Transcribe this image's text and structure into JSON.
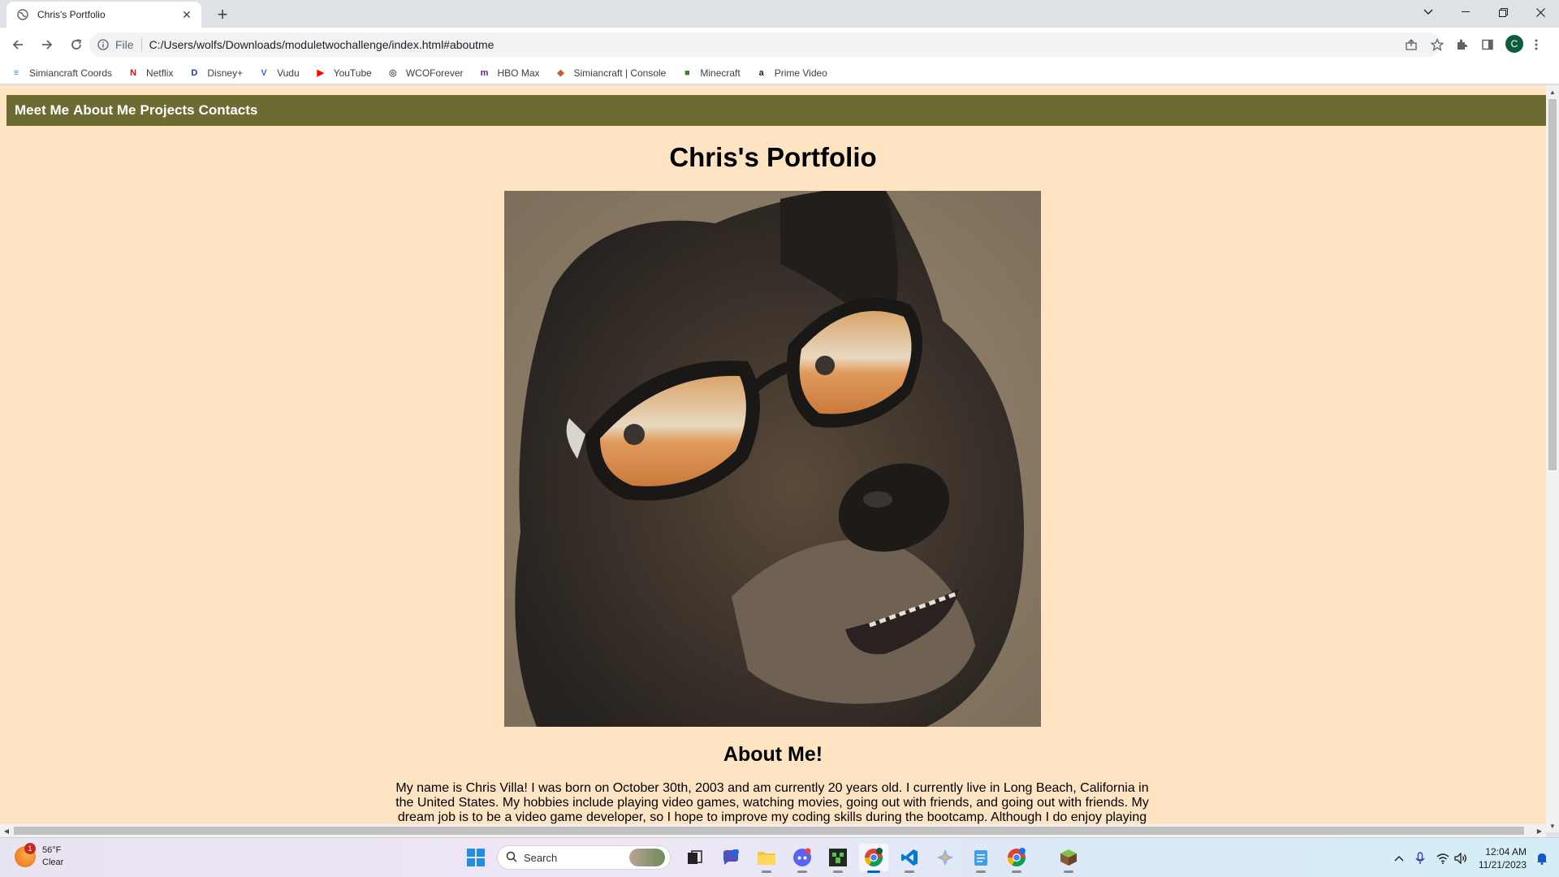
{
  "browser": {
    "tab_title": "Chris's Portfolio",
    "file_label": "File",
    "url": "C:/Users/wolfs/Downloads/moduletwochallenge/index.html#aboutme",
    "profile_initial": "C"
  },
  "bookmarks": [
    {
      "label": "Simiancraft Coords",
      "icon": "docs-icon",
      "color": "#4285f4"
    },
    {
      "label": "Netflix",
      "icon": "netflix-icon",
      "color": "#e50914"
    },
    {
      "label": "Disney+",
      "icon": "disney-icon",
      "color": "#1a3d9c"
    },
    {
      "label": "Vudu",
      "icon": "vudu-icon",
      "color": "#3b6fd6"
    },
    {
      "label": "YouTube",
      "icon": "youtube-icon",
      "color": "#ff0000"
    },
    {
      "label": "WCOForever",
      "icon": "globe-icon",
      "color": "#5f6368"
    },
    {
      "label": "HBO Max",
      "icon": "hbomax-icon",
      "color": "#5b1a8c"
    },
    {
      "label": "Simiancraft | Console",
      "icon": "console-icon",
      "color": "#c0632a"
    },
    {
      "label": "Minecraft",
      "icon": "minecraft-icon",
      "color": "#3c8527"
    },
    {
      "label": "Prime Video",
      "icon": "amazon-icon",
      "color": "#222222"
    }
  ],
  "site": {
    "nav": [
      "Meet Me",
      "About Me",
      "Projects",
      "Contacts"
    ],
    "title": "Chris's Portfolio",
    "about_heading": "About Me!",
    "about_text": "My name is Chris Villa! I was born on October 30th, 2003 and am currently 20 years old. I currently live in Long Beach, California in the United States. My hobbies include playing video games, watching movies, going out with friends, and going out with friends. My dream job is to be a video game developer, so I hope to improve my coding skills during the bootcamp. Although I do enjoy playing"
  },
  "taskbar": {
    "weather_temp": "56°F",
    "weather_desc": "Clear",
    "weather_badge": "1",
    "search_placeholder": "Search",
    "time": "12:04 AM",
    "date": "11/21/2023"
  }
}
